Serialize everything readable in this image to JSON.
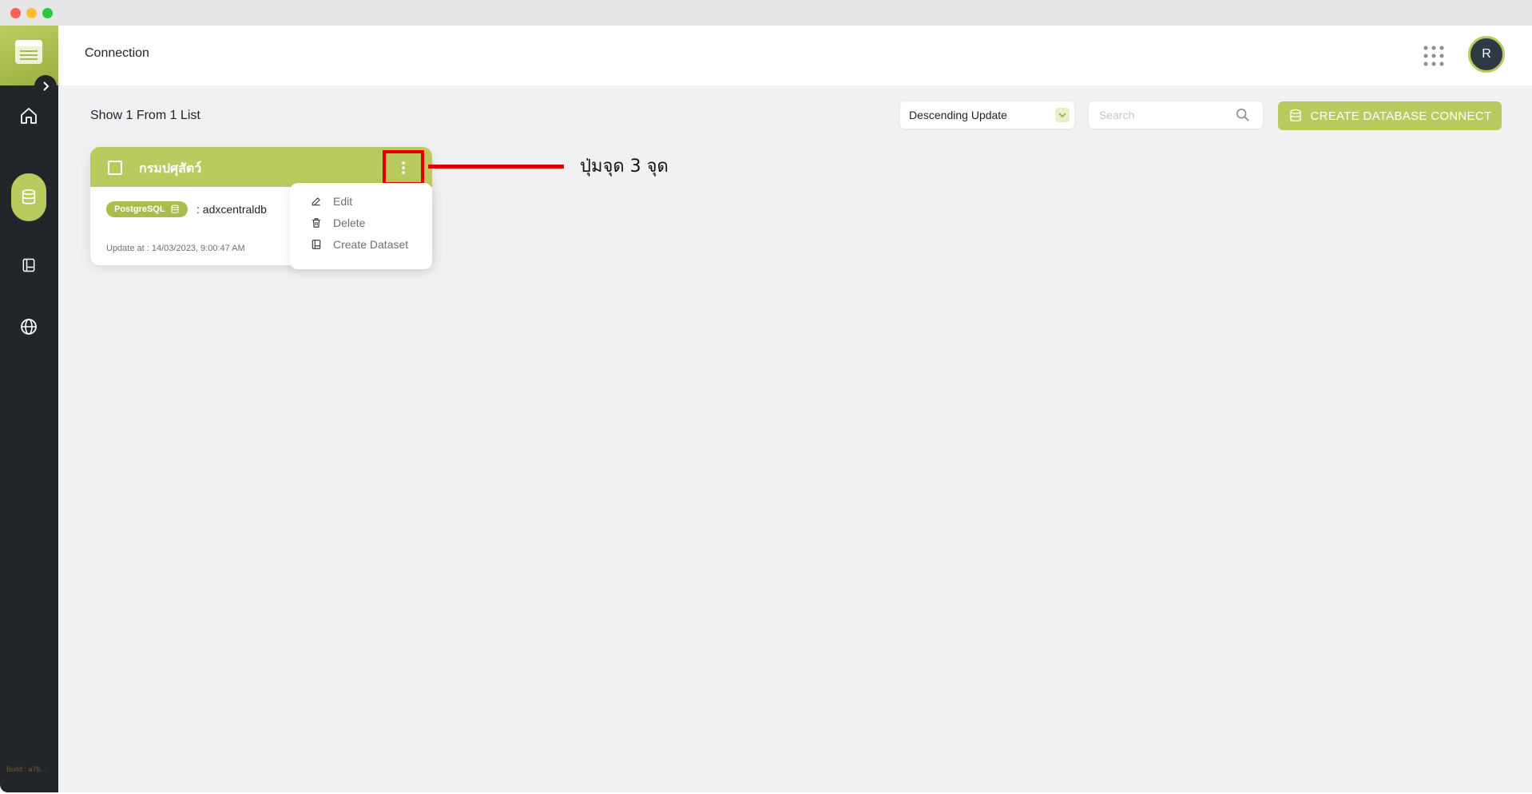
{
  "sidebar": {
    "expand_icon": "chevron-right-icon",
    "items": [
      {
        "name": "home",
        "icon": "home-icon",
        "active": false
      },
      {
        "name": "database",
        "icon": "database-icon",
        "active": true
      },
      {
        "name": "dataset",
        "icon": "book-icon",
        "active": false
      },
      {
        "name": "web",
        "icon": "globe-icon",
        "active": false
      }
    ],
    "build_label": "Build : a76..."
  },
  "header": {
    "title": "Connection",
    "apps_icon": "grid-icon",
    "avatar_initial": "R"
  },
  "toolbar": {
    "count_text": "Show 1 From 1 List",
    "sort_value": "Descending Update",
    "search_placeholder": "Search",
    "create_label": "CREATE DATABASE CONNECT"
  },
  "card": {
    "title": "กรมปศุสัตว์",
    "db_type": "PostgreSQL",
    "db_name": ": adxcentraldb",
    "updated": "Update at : 14/03/2023, 9:00:47 AM"
  },
  "menu": {
    "items": [
      {
        "label": "Edit",
        "icon": "edit-icon"
      },
      {
        "label": "Delete",
        "icon": "trash-icon"
      },
      {
        "label": "Create Dataset",
        "icon": "dataset-icon"
      }
    ]
  },
  "annotation": {
    "text": "ปุ่มจุด 3 จุด",
    "color": "#e00000"
  },
  "colors": {
    "accent": "#b9cb5e",
    "sidebar": "#22262b",
    "background": "#f0f1f3"
  }
}
